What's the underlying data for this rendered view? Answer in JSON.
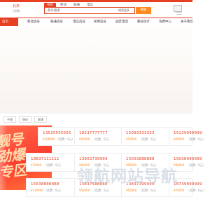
{
  "header": {
    "city": "北京",
    "city_switch": "[切换]",
    "tabs": [
      "号码",
      "移动",
      "联通",
      "电信"
    ],
    "search_placeholder": "靓号搜索",
    "search_filter": "搜索更多",
    "search_button": "搜索"
  },
  "nav": {
    "home": "首页",
    "items": [
      "移动选号",
      "联通选号",
      "电信选号",
      "民用选号",
      "固定电话",
      "靓号估计",
      "淘费中心",
      "关于我们"
    ]
  },
  "filters": [
    "不限",
    "移动",
    "联通"
  ],
  "promo": {
    "text": "靓号\n劲爆\n专区"
  },
  "cards": [
    {
      "number": "13525555555",
      "price": "¥188000",
      "note": "（话费：0元）"
    },
    {
      "number": "18237777777",
      "price": "¥90000",
      "note": "（话费：0元）"
    },
    {
      "number": "15093333333",
      "price": "¥53000",
      "note": "（话费：0元）"
    },
    {
      "number": "15139999999",
      "price": "¥90000",
      "note": "（话费：0元）"
    },
    {
      "number": "18837111111",
      "price": "¥35000",
      "note": "（话费：0元）"
    },
    {
      "number": "13903739999",
      "price": "¥99999",
      "note": "（话费：0元）"
    },
    {
      "number": "15003888888",
      "price": "¥96000",
      "note": "（话费：0元）"
    },
    {
      "number": "15036999999",
      "price": "¥88000",
      "note": "（话费：0元）"
    },
    {
      "number": "15638888888",
      "price": "¥130000",
      "note": "（话费：0元）"
    },
    {
      "number": "13837588888",
      "price": "¥58000",
      "note": "（话费：0元）"
    },
    {
      "number": "13837399999",
      "price": "¥62000",
      "note": "（话费：0元）"
    },
    {
      "number": "18739899999",
      "price": "¥76000",
      "note": "（话费：0元）"
    }
  ],
  "watermark": "领航网站导航",
  "colors": {
    "accent": "#e63f22",
    "orange": "#ff8a1f"
  }
}
